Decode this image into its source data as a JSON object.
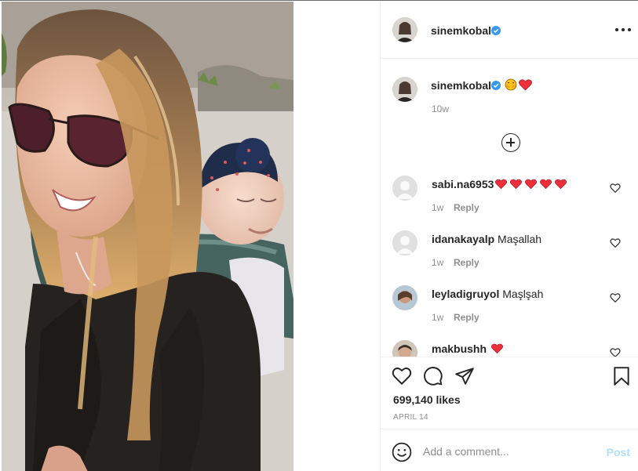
{
  "post": {
    "author": "sinemkobal",
    "caption_emojis": [
      "hug-emoji",
      "red-heart-emoji"
    ],
    "caption_time": "10w",
    "likes": "699,140 likes",
    "date": "APRIL 14"
  },
  "comments": [
    {
      "username": "sabi.na6953",
      "text": "",
      "hearts": 5,
      "time": "1w",
      "reply": "Reply"
    },
    {
      "username": "idanakayalp",
      "text": "Maşallah",
      "hearts": 0,
      "time": "1w",
      "reply": "Reply"
    },
    {
      "username": "leyladigruyol",
      "text": "Maşlşah",
      "hearts": 0,
      "time": "1w",
      "reply": "Reply"
    },
    {
      "username": "makbushh",
      "text": "",
      "hearts": 1,
      "time": "",
      "reply": ""
    }
  ],
  "add_comment": {
    "placeholder": "Add a comment...",
    "post_label": "Post"
  },
  "colors": {
    "verified": "#3897f0",
    "heart": "#ed2f3c",
    "post_disabled": "#b2dffc",
    "muted": "#8e8e8e"
  }
}
